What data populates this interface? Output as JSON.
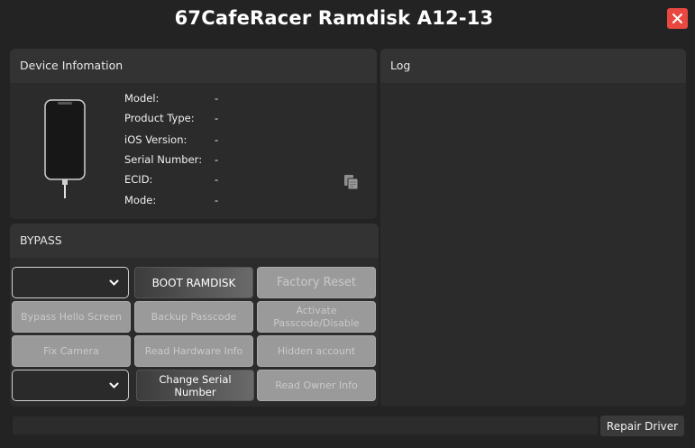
{
  "window": {
    "title": "67CafeRacer Ramdisk A12-13",
    "close_icon": "close-icon",
    "close_color": "#e8483f"
  },
  "device_panel": {
    "header": "Device Infomation",
    "phone_icon": "iphone-icon",
    "fields": [
      {
        "label": "Model:",
        "value": "-"
      },
      {
        "label": "Product Type:",
        "value": "-"
      },
      {
        "label": "iOS Version:",
        "value": "-"
      },
      {
        "label": "Serial Number:",
        "value": "-"
      },
      {
        "label": "ECID:",
        "value": "-"
      },
      {
        "label": "Mode:",
        "value": "-"
      }
    ],
    "copy_icon": "copy-icon"
  },
  "log_panel": {
    "header": "Log"
  },
  "bypass_panel": {
    "header": "BYPASS",
    "select1_value": "",
    "select2_value": "",
    "buttons": {
      "boot_ramdisk": "BOOT RAMDISK",
      "factory_reset": "Factory Reset",
      "bypass_hello": "Bypass Hello Screen",
      "backup_passcode": "Backup Passcode",
      "activate_passcode_line1": "Activate",
      "activate_passcode_line2": "Passcode/Disable",
      "fix_camera": "Fix Camera",
      "read_hardware": "Read Hardware Info",
      "hidden_account": "Hidden account",
      "change_serial_line1": "Change Serial",
      "change_serial_line2": "Number",
      "read_owner": "Read Owner Info"
    }
  },
  "footer": {
    "repair_driver": "Repair Driver"
  }
}
